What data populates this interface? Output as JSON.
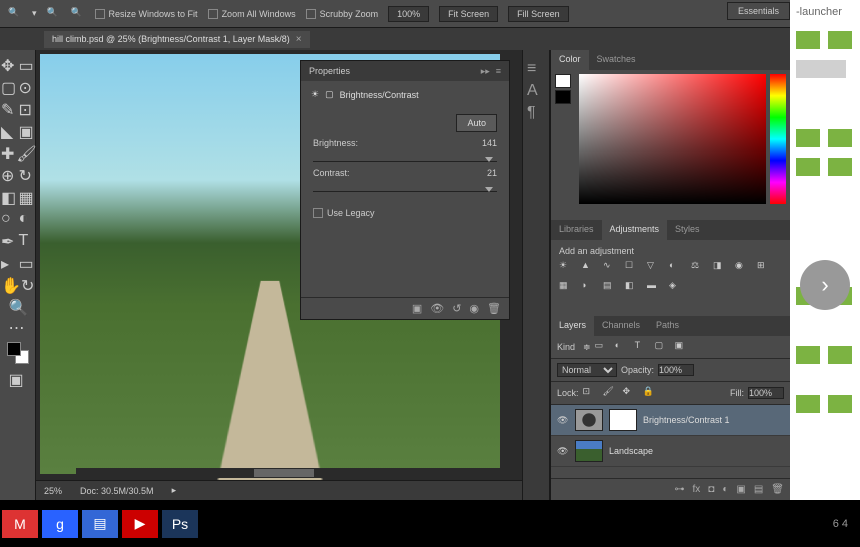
{
  "background": {
    "launcher_text": "-launcher"
  },
  "options_bar": {
    "resize_windows": "Resize Windows to Fit",
    "zoom_all": "Zoom All Windows",
    "scrubby": "Scrubby Zoom",
    "b100": "100%",
    "fit": "Fit Screen",
    "fill": "Fill Screen",
    "workspace": "Essentials"
  },
  "doc_tab": {
    "title": "hill climb.psd @ 25% (Brightness/Contrast 1, Layer Mask/8)"
  },
  "status": {
    "zoom": "25%",
    "doc": "Doc: 30.5M/30.5M"
  },
  "properties": {
    "panel_name": "Properties",
    "adjustment_title": "Brightness/Contrast",
    "auto": "Auto",
    "brightness_label": "Brightness:",
    "brightness_value": "141",
    "contrast_label": "Contrast:",
    "contrast_value": "21",
    "use_legacy": "Use Legacy"
  },
  "color_panel": {
    "tab_color": "Color",
    "tab_swatches": "Swatches"
  },
  "adjustments": {
    "tab_libraries": "Libraries",
    "tab_adjustments": "Adjustments",
    "tab_styles": "Styles",
    "add_label": "Add an adjustment"
  },
  "layers": {
    "tab_layers": "Layers",
    "tab_channels": "Channels",
    "tab_paths": "Paths",
    "kind": "Kind",
    "blend": "Normal",
    "opacity_label": "Opacity:",
    "opacity_value": "100%",
    "lock_label": "Lock:",
    "fill_label": "Fill:",
    "fill_value": "100%",
    "items": [
      {
        "name": "Brightness/Contrast 1"
      },
      {
        "name": "Landscape"
      }
    ]
  },
  "taskbar": {
    "right": "6    4"
  }
}
